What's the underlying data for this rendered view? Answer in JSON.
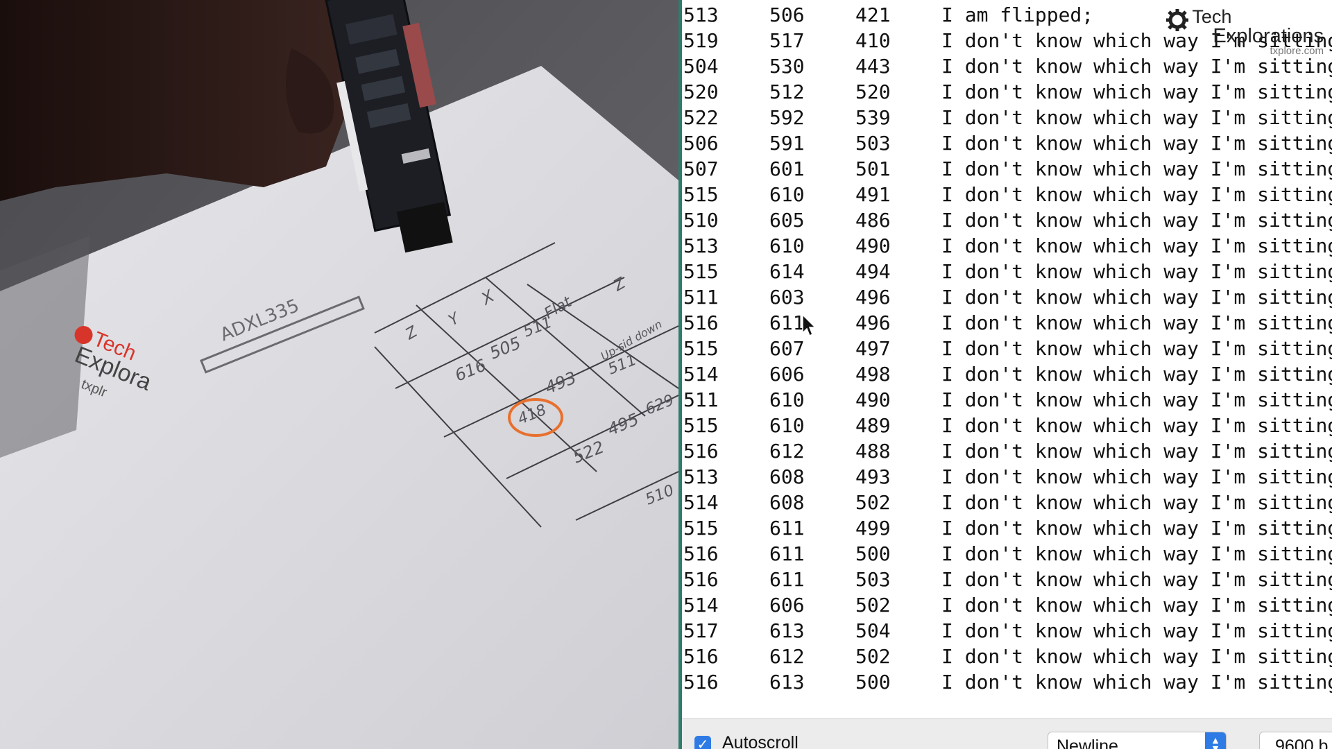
{
  "photo": {
    "paper_labels": {
      "chip": "ADXL335",
      "logo_line1": "Tech",
      "logo_line2": "Explora",
      "logo_line3": "txplr",
      "col_x": "X",
      "col_y": "Y",
      "col_z": "Z",
      "col_flat": "Flat",
      "col_upside_down": "Up-sid down",
      "row_z": "Z",
      "v511": "511",
      "v505": "505",
      "v616": "616",
      "v493": "493",
      "v418": "418",
      "v495": "495",
      "v522": "522",
      "v511b": "511",
      "v629": "629",
      "v510": "510"
    }
  },
  "monitor": {
    "brand": {
      "line1": "Tech",
      "line2": "Explorations",
      "url": "txplore.com"
    },
    "rows": [
      [
        "513",
        "506",
        "421",
        "I am flipped;"
      ],
      [
        "519",
        "517",
        "410",
        "I don't know which way I'm sitting!"
      ],
      [
        "504",
        "530",
        "443",
        "I don't know which way I'm sitting!"
      ],
      [
        "520",
        "512",
        "520",
        "I don't know which way I'm sitting!"
      ],
      [
        "522",
        "592",
        "539",
        "I don't know which way I'm sitting!"
      ],
      [
        "506",
        "591",
        "503",
        "I don't know which way I'm sitting!"
      ],
      [
        "507",
        "601",
        "501",
        "I don't know which way I'm sitting!"
      ],
      [
        "515",
        "610",
        "491",
        "I don't know which way I'm sitting!"
      ],
      [
        "510",
        "605",
        "486",
        "I don't know which way I'm sitting!"
      ],
      [
        "513",
        "610",
        "490",
        "I don't know which way I'm sitting!"
      ],
      [
        "515",
        "614",
        "494",
        "I don't know which way I'm sitting!"
      ],
      [
        "511",
        "603",
        "496",
        "I don't know which way I'm sitting!"
      ],
      [
        "516",
        "611",
        "496",
        "I don't know which way I'm sitting!"
      ],
      [
        "515",
        "607",
        "497",
        "I don't know which way I'm sitting!"
      ],
      [
        "514",
        "606",
        "498",
        "I don't know which way I'm sitting!"
      ],
      [
        "511",
        "610",
        "490",
        "I don't know which way I'm sitting!"
      ],
      [
        "515",
        "610",
        "489",
        "I don't know which way I'm sitting!"
      ],
      [
        "516",
        "612",
        "488",
        "I don't know which way I'm sitting!"
      ],
      [
        "513",
        "608",
        "493",
        "I don't know which way I'm sitting!"
      ],
      [
        "514",
        "608",
        "502",
        "I don't know which way I'm sitting!"
      ],
      [
        "515",
        "611",
        "499",
        "I don't know which way I'm sitting!"
      ],
      [
        "516",
        "611",
        "500",
        "I don't know which way I'm sitting!"
      ],
      [
        "516",
        "611",
        "503",
        "I don't know which way I'm sitting!"
      ],
      [
        "514",
        "606",
        "502",
        "I don't know which way I'm sitting!"
      ],
      [
        "517",
        "613",
        "504",
        "I don't know which way I'm sitting!"
      ],
      [
        "516",
        "612",
        "502",
        "I don't know which way I'm sitting!"
      ],
      [
        "516",
        "613",
        "500",
        "I don't know which way I'm sitting!"
      ]
    ],
    "bottom_bar": {
      "autoscroll_label": "Autoscroll",
      "autoscroll_checked": true,
      "line_ending": "Newline",
      "baud": "9600 b"
    }
  }
}
